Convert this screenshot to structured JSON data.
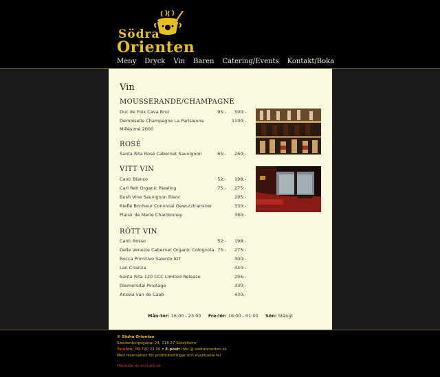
{
  "logo": {
    "line1": "Södra",
    "line2": "Orienten"
  },
  "nav": [
    "Meny",
    "Dryck",
    "Vin",
    "Baren",
    "Catering/Events",
    "Kontakt/Boka"
  ],
  "page_title": "Vin",
  "sections": [
    {
      "title": "MOUSSERANDE/CHAMPAGNE",
      "items": [
        {
          "name": "Duc de Foix Cava Brut",
          "glass": "95:-",
          "bottle": "500:-"
        },
        {
          "name": "Demoiselle Champagne La Parisienne Millésimé 2000",
          "glass": "",
          "bottle": "1100:-"
        }
      ]
    },
    {
      "title": "ROSÉ",
      "items": [
        {
          "name": "Santa Rita Rosé Cabernet Sauvignon",
          "glass": "65:-",
          "bottle": "260:-"
        }
      ]
    },
    {
      "title": "VITT VIN",
      "items": [
        {
          "name": "Canti Bianco",
          "glass": "52:-",
          "bottle": "198:-"
        },
        {
          "name": "Carl Reh Organic Riesling",
          "glass": "75:-",
          "bottle": "275:-"
        },
        {
          "name": "Bush Vine Sauvignon Blanc",
          "glass": "",
          "bottle": "295:-"
        },
        {
          "name": "Rieflé Bonheur Convivial Gewurztraminer",
          "glass": "",
          "bottle": "330:-"
        },
        {
          "name": "Plaisir de Merle Chardonnay",
          "glass": "",
          "bottle": "380:-"
        }
      ]
    },
    {
      "title": "RÖTT VIN",
      "items": [
        {
          "name": "Canti Rosso",
          "glass": "52:-",
          "bottle": "198:-"
        },
        {
          "name": "Delle Venezie Cabernet Organic Colognola",
          "glass": "75:-",
          "bottle": "275:-"
        },
        {
          "name": "Rocca Primitivo Salento IGT",
          "glass": "",
          "bottle": "300:-"
        },
        {
          "name": "Lan Crianza",
          "glass": "",
          "bottle": "340:-"
        },
        {
          "name": "Santa Rita 120 CCC Limited Release",
          "glass": "",
          "bottle": "295:-"
        },
        {
          "name": "Diemersdal Pinotage",
          "glass": "",
          "bottle": "330:-"
        },
        {
          "name": "Ansela van de Caab",
          "glass": "",
          "bottle": "430:-"
        }
      ]
    }
  ],
  "hours": {
    "mon_label": "Mån-tor:",
    "mon": "16:00 - 23:00",
    "fri_label": "Fre-lör:",
    "fri": "16:00 - 01:00",
    "sun_label": "Sön:",
    "sun": "Stängt"
  },
  "footer": {
    "name": "© Södra Orienten",
    "address": "Swedenborgsgatan 24, 118 27 Stockholm",
    "phone_label": "Telefon:",
    "phone": "08-720 33 50",
    "email_label": "E-post:",
    "email": "info @ sodraorienten.se",
    "reservation": "Med reservation för prisförändringar och eventuella fel",
    "credit_label": "Hemsida av",
    "credit": "soccarb.se"
  },
  "colors": {
    "accent": "#e8c21a",
    "content_bg": "#fbf9de",
    "page_bg": "#1b1b1b"
  }
}
